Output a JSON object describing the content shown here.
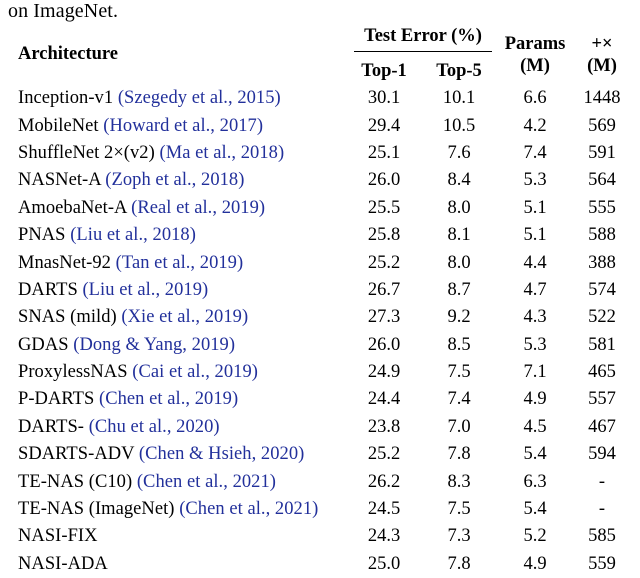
{
  "caption_fragment": "on ImageNet.",
  "colors": {
    "citation": "#22309b",
    "text": "#000000",
    "rule": "#000000"
  },
  "header": {
    "architecture": "Architecture",
    "test_error_group": "Test Error (%)",
    "top1": "Top-1",
    "top5": "Top-5",
    "params_line1": "Params",
    "params_line2": "(M)",
    "madds_line1": "+×",
    "madds_line2": "(M)"
  },
  "groups": [
    {
      "rows": [
        {
          "name": "Inception-v1 ",
          "citation": "(Szegedy et al., 2015)",
          "top1": "30.1",
          "top5": "10.1",
          "params": "6.6",
          "madds": "1448"
        },
        {
          "name": "MobileNet ",
          "citation": "(Howard et al., 2017)",
          "top1": "29.4",
          "top5": "10.5",
          "params": "4.2",
          "madds": "569"
        },
        {
          "name": "ShuffleNet 2×(v2) ",
          "citation": "(Ma et al., 2018)",
          "top1": "25.1",
          "top5": "7.6",
          "params": "7.4",
          "madds": "591"
        }
      ]
    },
    {
      "rows": [
        {
          "name": "NASNet-A ",
          "citation": "(Zoph et al., 2018)",
          "top1": "26.0",
          "top5": "8.4",
          "params": "5.3",
          "madds": "564"
        },
        {
          "name": "AmoebaNet-A ",
          "citation": "(Real et al., 2019)",
          "top1": "25.5",
          "top5": "8.0",
          "params": "5.1",
          "madds": "555"
        },
        {
          "name": "PNAS ",
          "citation": "(Liu et al., 2018)",
          "top1": "25.8",
          "top5": "8.1",
          "params": "5.1",
          "madds": "588"
        },
        {
          "name": "MnasNet-92 ",
          "citation": "(Tan et al., 2019)",
          "top1": "25.2",
          "top5": "8.0",
          "params": "4.4",
          "madds": "388"
        }
      ]
    },
    {
      "rows": [
        {
          "name": "DARTS ",
          "citation": "(Liu et al., 2019)",
          "top1": "26.7",
          "top5": "8.7",
          "params": "4.7",
          "madds": "574"
        },
        {
          "name": "SNAS (mild) ",
          "citation": "(Xie et al., 2019)",
          "top1": "27.3",
          "top5": "9.2",
          "params": "4.3",
          "madds": "522"
        },
        {
          "name": "GDAS ",
          "citation": "(Dong & Yang, 2019)",
          "top1": "26.0",
          "top5": "8.5",
          "params": "5.3",
          "madds": "581"
        },
        {
          "name": "ProxylessNAS ",
          "citation": "(Cai et al., 2019)",
          "top1": "24.9",
          "top5": "7.5",
          "params": "7.1",
          "madds": "465"
        },
        {
          "name": "P-DARTS ",
          "citation": "(Chen et al., 2019)",
          "top1": "24.4",
          "top5": "7.4",
          "params": "4.9",
          "madds": "557"
        },
        {
          "name": "DARTS- ",
          "citation": "(Chu et al., 2020)",
          "top1": "23.8",
          "top5": "7.0",
          "params": "4.5",
          "madds": "467"
        },
        {
          "name": "SDARTS-ADV ",
          "citation": "(Chen & Hsieh, 2020)",
          "top1": "25.2",
          "top5": "7.8",
          "params": "5.4",
          "madds": "594"
        }
      ]
    },
    {
      "rows": [
        {
          "name": "TE-NAS (C10) ",
          "citation": "(Chen et al., 2021)",
          "top1": "26.2",
          "top5": "8.3",
          "params": "6.3",
          "madds": "-"
        },
        {
          "name": "TE-NAS (ImageNet) ",
          "citation": "(Chen et al., 2021)",
          "top1": "24.5",
          "top5": "7.5",
          "params": "5.4",
          "madds": "-"
        }
      ]
    },
    {
      "rows": [
        {
          "name": "NASI-FIX",
          "citation": "",
          "top1": "24.3",
          "top5": "7.3",
          "params": "5.2",
          "madds": "585"
        },
        {
          "name": "NASI-ADA",
          "citation": "",
          "top1": "25.0",
          "top5": "7.8",
          "params": "4.9",
          "madds": "559"
        }
      ]
    }
  ]
}
